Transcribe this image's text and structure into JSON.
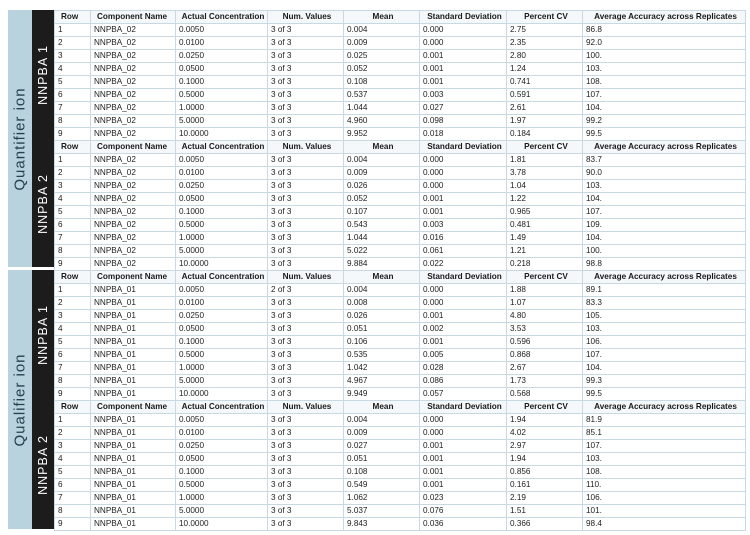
{
  "groups": [
    {
      "label": "Quantifier ion",
      "subs": [
        {
          "label": "NNPBA 1",
          "columns": [
            "Row",
            "Component Name",
            "Actual Concentration",
            "Num. Values",
            "Mean",
            "Standard Deviation",
            "Percent CV",
            "Average Accuracy across Replicates"
          ],
          "rows": [
            [
              "1",
              "NNPBA_02",
              "0.0050",
              "3 of 3",
              "0.004",
              "0.000",
              "2.75",
              "86.8"
            ],
            [
              "2",
              "NNPBA_02",
              "0.0100",
              "3 of 3",
              "0.009",
              "0.000",
              "2.35",
              "92.0"
            ],
            [
              "3",
              "NNPBA_02",
              "0.0250",
              "3 of 3",
              "0.025",
              "0.001",
              "2.80",
              "100."
            ],
            [
              "4",
              "NNPBA_02",
              "0.0500",
              "3 of 3",
              "0.052",
              "0.001",
              "1.24",
              "103."
            ],
            [
              "5",
              "NNPBA_02",
              "0.1000",
              "3 of 3",
              "0.108",
              "0.001",
              "0.741",
              "108."
            ],
            [
              "6",
              "NNPBA_02",
              "0.5000",
              "3 of 3",
              "0.537",
              "0.003",
              "0.591",
              "107."
            ],
            [
              "7",
              "NNPBA_02",
              "1.0000",
              "3 of 3",
              "1.044",
              "0.027",
              "2.61",
              "104."
            ],
            [
              "8",
              "NNPBA_02",
              "5.0000",
              "3 of 3",
              "4.960",
              "0.098",
              "1.97",
              "99.2"
            ],
            [
              "9",
              "NNPBA_02",
              "10.0000",
              "3 of 3",
              "9.952",
              "0.018",
              "0.184",
              "99.5"
            ]
          ]
        },
        {
          "label": "NNPBA 2",
          "columns": [
            "Row",
            "Component Name",
            "Actual Concentration",
            "Num. Values",
            "Mean",
            "Standard Deviation",
            "Percent CV",
            "Average Accuracy across Replicates"
          ],
          "rows": [
            [
              "1",
              "NNPBA_02",
              "0.0050",
              "3 of 3",
              "0.004",
              "0.000",
              "1.81",
              "83.7"
            ],
            [
              "2",
              "NNPBA_02",
              "0.0100",
              "3 of 3",
              "0.009",
              "0.000",
              "3.78",
              "90.0"
            ],
            [
              "3",
              "NNPBA_02",
              "0.0250",
              "3 of 3",
              "0.026",
              "0.000",
              "1.04",
              "103."
            ],
            [
              "4",
              "NNPBA_02",
              "0.0500",
              "3 of 3",
              "0.052",
              "0.001",
              "1.22",
              "104."
            ],
            [
              "5",
              "NNPBA_02",
              "0.1000",
              "3 of 3",
              "0.107",
              "0.001",
              "0.965",
              "107."
            ],
            [
              "6",
              "NNPBA_02",
              "0.5000",
              "3 of 3",
              "0.543",
              "0.003",
              "0.481",
              "109."
            ],
            [
              "7",
              "NNPBA_02",
              "1.0000",
              "3 of 3",
              "1.044",
              "0.016",
              "1.49",
              "104."
            ],
            [
              "8",
              "NNPBA_02",
              "5.0000",
              "3 of 3",
              "5.022",
              "0.061",
              "1.21",
              "100."
            ],
            [
              "9",
              "NNPBA_02",
              "10.0000",
              "3 of 3",
              "9.884",
              "0.022",
              "0.218",
              "98.8"
            ]
          ]
        }
      ]
    },
    {
      "label": "Qualifier ion",
      "subs": [
        {
          "label": "NNPBA 1",
          "columns": [
            "Row",
            "Component Name",
            "Actual Concentration",
            "Num. Values",
            "Mean",
            "Standard Deviation",
            "Percent CV",
            "Average Accuracy across Replicates"
          ],
          "rows": [
            [
              "1",
              "NNPBA_01",
              "0.0050",
              "2 of 3",
              "0.004",
              "0.000",
              "1.88",
              "89.1"
            ],
            [
              "2",
              "NNPBA_01",
              "0.0100",
              "3 of 3",
              "0.008",
              "0.000",
              "1.07",
              "83.3"
            ],
            [
              "3",
              "NNPBA_01",
              "0.0250",
              "3 of 3",
              "0.026",
              "0.001",
              "4.80",
              "105."
            ],
            [
              "4",
              "NNPBA_01",
              "0.0500",
              "3 of 3",
              "0.051",
              "0.002",
              "3.53",
              "103."
            ],
            [
              "5",
              "NNPBA_01",
              "0.1000",
              "3 of 3",
              "0.106",
              "0.001",
              "0.596",
              "106."
            ],
            [
              "6",
              "NNPBA_01",
              "0.5000",
              "3 of 3",
              "0.535",
              "0.005",
              "0.868",
              "107."
            ],
            [
              "7",
              "NNPBA_01",
              "1.0000",
              "3 of 3",
              "1.042",
              "0.028",
              "2.67",
              "104."
            ],
            [
              "8",
              "NNPBA_01",
              "5.0000",
              "3 of 3",
              "4.967",
              "0.086",
              "1.73",
              "99.3"
            ],
            [
              "9",
              "NNPBA_01",
              "10.0000",
              "3 of 3",
              "9.949",
              "0.057",
              "0.568",
              "99.5"
            ]
          ]
        },
        {
          "label": "NNPBA 2",
          "columns": [
            "Row",
            "Component Name",
            "Actual Concentration",
            "Num. Values",
            "Mean",
            "Standard Deviation",
            "Percent CV",
            "Average Accuracy across Replicates"
          ],
          "rows": [
            [
              "1",
              "NNPBA_01",
              "0.0050",
              "3 of 3",
              "0.004",
              "0.000",
              "1.94",
              "81.9"
            ],
            [
              "2",
              "NNPBA_01",
              "0.0100",
              "3 of 3",
              "0.009",
              "0.000",
              "4.02",
              "85.1"
            ],
            [
              "3",
              "NNPBA_01",
              "0.0250",
              "3 of 3",
              "0.027",
              "0.001",
              "2.97",
              "107."
            ],
            [
              "4",
              "NNPBA_01",
              "0.0500",
              "3 of 3",
              "0.051",
              "0.001",
              "1.94",
              "103."
            ],
            [
              "5",
              "NNPBA_01",
              "0.1000",
              "3 of 3",
              "0.108",
              "0.001",
              "0.856",
              "108."
            ],
            [
              "6",
              "NNPBA_01",
              "0.5000",
              "3 of 3",
              "0.549",
              "0.001",
              "0.161",
              "110."
            ],
            [
              "7",
              "NNPBA_01",
              "1.0000",
              "3 of 3",
              "1.062",
              "0.023",
              "2.19",
              "106."
            ],
            [
              "8",
              "NNPBA_01",
              "5.0000",
              "3 of 3",
              "5.037",
              "0.076",
              "1.51",
              "101."
            ],
            [
              "9",
              "NNPBA_01",
              "10.0000",
              "3 of 3",
              "9.843",
              "0.036",
              "0.366",
              "98.4"
            ]
          ]
        }
      ]
    }
  ]
}
